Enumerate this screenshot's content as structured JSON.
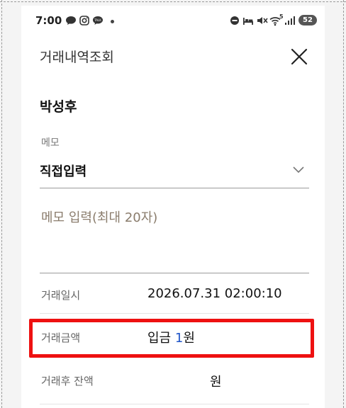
{
  "status_bar": {
    "time": "7:00",
    "battery": "52",
    "wifi_badge": "5"
  },
  "header": {
    "title": "거래내역조회"
  },
  "account_holder": "박성후",
  "memo": {
    "label": "메모",
    "selected_option": "직접입력",
    "input_placeholder": "메모 입력(최대 20자)",
    "input_value": ""
  },
  "details": {
    "date_label": "거래일시",
    "date_value": "2026.07.31 02:00:10",
    "amount_label": "거래금액",
    "amount_type": "입금",
    "amount_number": "1",
    "amount_unit": "원",
    "balance_label": "거래후 잔액",
    "balance_unit": "원"
  },
  "colors": {
    "highlight_border": "#ee1111",
    "amount_number": "#1f55c8"
  }
}
